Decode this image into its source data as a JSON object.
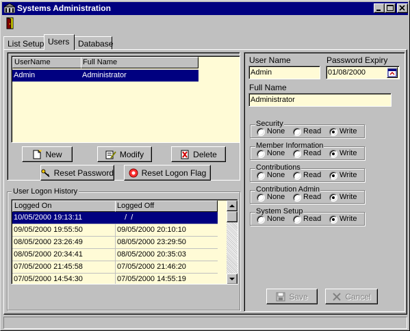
{
  "window": {
    "title": "Systems Administration",
    "icons": [
      "app-icon",
      "minimize-icon",
      "maximize-icon",
      "close-icon"
    ]
  },
  "toolbar": {
    "exit_icon": "exit-door-icon"
  },
  "tabs": [
    {
      "label": "List Setup",
      "active": false
    },
    {
      "label": "Users",
      "active": true
    },
    {
      "label": "Database",
      "active": false
    }
  ],
  "users_grid": {
    "columns": [
      "UserName",
      "Full Name"
    ],
    "rows": [
      {
        "username": "Admin",
        "fullname": "Administrator",
        "selected": true
      }
    ]
  },
  "user_buttons": {
    "new": "New",
    "modify": "Modify",
    "delete": "Delete",
    "reset_password": "Reset Password",
    "reset_logon_flag": "Reset Logon Flag"
  },
  "logon_history": {
    "title": "User Logon History",
    "columns": [
      "Logged On",
      "Logged Off"
    ],
    "rows": [
      {
        "on": "10/05/2000 19:13:11",
        "off": "  /  /",
        "selected": true
      },
      {
        "on": "09/05/2000 19:55:50",
        "off": "09/05/2000 20:10:10",
        "selected": false
      },
      {
        "on": "08/05/2000 23:26:49",
        "off": "08/05/2000 23:29:50",
        "selected": false
      },
      {
        "on": "08/05/2000 20:34:41",
        "off": "08/05/2000 20:35:03",
        "selected": false
      },
      {
        "on": "07/05/2000 21:45:58",
        "off": "07/05/2000 21:46:20",
        "selected": false
      },
      {
        "on": "07/05/2000 14:54:30",
        "off": "07/05/2000 14:55:19",
        "selected": false
      }
    ]
  },
  "details": {
    "username_label": "User Name",
    "username_value": "Admin",
    "expiry_label": "Password Expiry",
    "expiry_value": "01/08/2000",
    "fullname_label": "Full Name",
    "fullname_value": "Administrator"
  },
  "permissions": [
    {
      "title": "Security",
      "selected": "Write"
    },
    {
      "title": "Member Information",
      "selected": "Write"
    },
    {
      "title": "Contributions",
      "selected": "Write"
    },
    {
      "title": "Contribution Admin",
      "selected": "Write"
    },
    {
      "title": "System Setup",
      "selected": "Write"
    }
  ],
  "permission_options": [
    "None",
    "Read",
    "Write"
  ],
  "actions": {
    "save": "Save",
    "cancel": "Cancel"
  },
  "colors": {
    "titlebar": "#000080",
    "field_bg": "#fffbd6",
    "selection": "#000080",
    "face": "#c0c0c0"
  }
}
